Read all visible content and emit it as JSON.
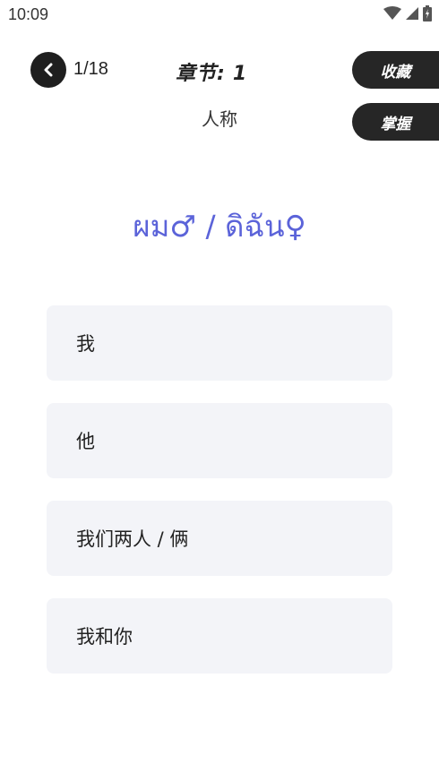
{
  "status": {
    "time": "10:09"
  },
  "header": {
    "progress": "1/18",
    "chapter_label": "章节:",
    "chapter_number": "1",
    "subtitle": "人称",
    "favorite_label": "收藏",
    "master_label": "掌握"
  },
  "question": {
    "word": "ผม♂ / ดิฉัน♀"
  },
  "options": [
    {
      "label": "我"
    },
    {
      "label": "他"
    },
    {
      "label": "我们两人 / 俩"
    },
    {
      "label": "我和你"
    }
  ],
  "colors": {
    "accent": "#5b63d9",
    "dark": "#262626",
    "option_bg": "#f3f4f8"
  }
}
